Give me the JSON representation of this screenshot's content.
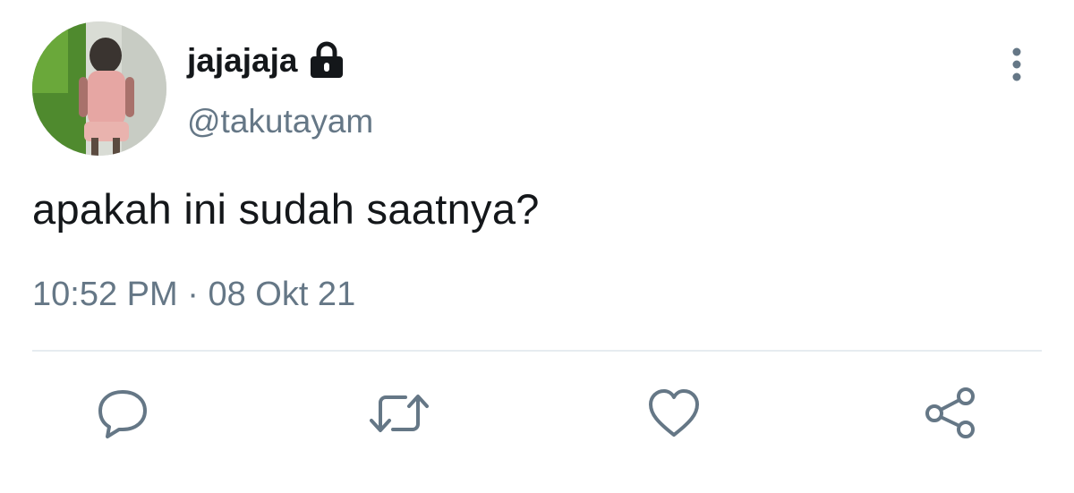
{
  "user": {
    "display_name": "jajajaja",
    "handle": "@takutayam",
    "protected_icon": "lock-icon",
    "avatar": "profile-photo"
  },
  "tweet": {
    "text": "apakah ini sudah saatnya?",
    "time": "10:52 PM",
    "separator": "·",
    "date": "08 Okt 21"
  },
  "actions": {
    "menu_icon": "more-vertical-icon",
    "reply_icon": "reply-icon",
    "retweet_icon": "retweet-icon",
    "like_icon": "heart-icon",
    "share_icon": "share-icon"
  },
  "colors": {
    "text_primary": "#14171a",
    "text_secondary": "#657786",
    "divider": "#e6ecf0"
  }
}
